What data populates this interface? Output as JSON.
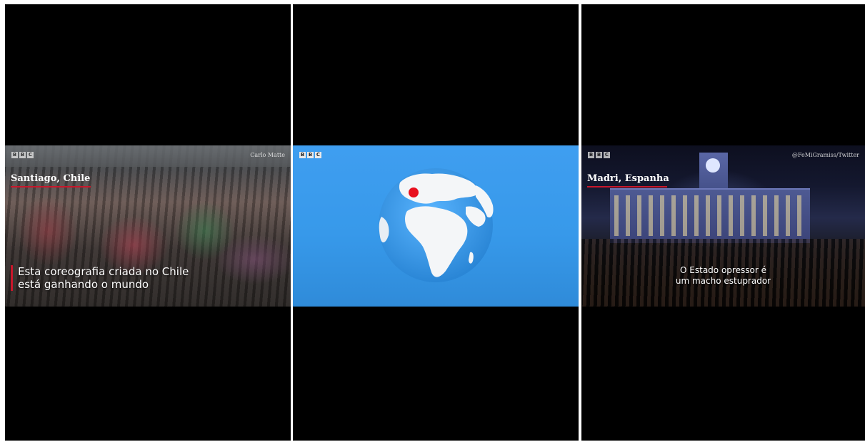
{
  "panels": [
    {
      "logo": [
        "B",
        "B",
        "C"
      ],
      "credit": "Carlo Matte",
      "location": "Santiago, Chile",
      "headline_line1": "Esta coreografia criada no Chile",
      "headline_line2": "está ganhando o mundo"
    },
    {
      "logo": [
        "B",
        "B",
        "C"
      ],
      "marker_color": "#e8101e"
    },
    {
      "logo": [
        "B",
        "B",
        "C"
      ],
      "credit": "@FeMiGramiss/Twitter",
      "location": "Madri, Espanha",
      "subtitle_line1": "O Estado opressor é",
      "subtitle_line2": "um macho estuprador"
    }
  ],
  "colors": {
    "accent_red": "#c9172b",
    "globe_blue": "#3f9ef0"
  }
}
